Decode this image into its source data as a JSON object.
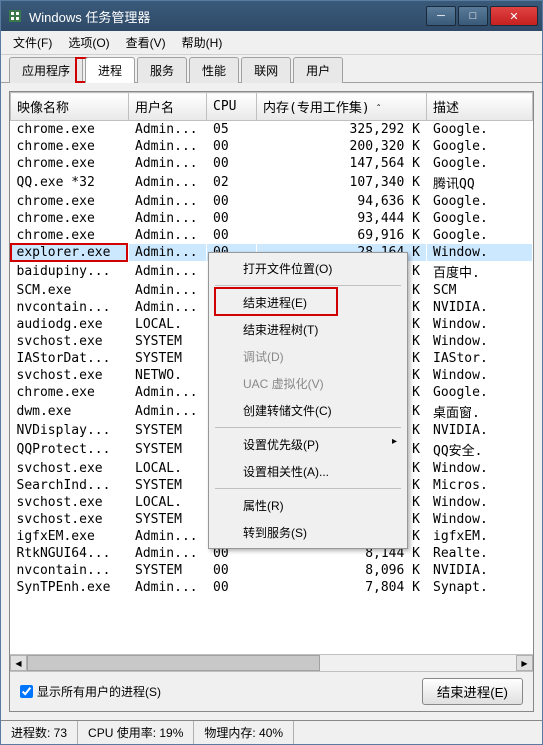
{
  "window": {
    "title": "Windows 任务管理器"
  },
  "menu": {
    "file": "文件(F)",
    "options": "选项(O)",
    "view": "查看(V)",
    "help": "帮助(H)"
  },
  "tabs": {
    "apps": "应用程序",
    "processes": "进程",
    "services": "服务",
    "performance": "性能",
    "networking": "联网",
    "users": "用户"
  },
  "columns": {
    "image": "映像名称",
    "user": "用户名",
    "cpu": "CPU",
    "memory": "内存(专用工作集)",
    "description": "描述"
  },
  "rows": [
    {
      "image": "chrome.exe",
      "user": "Admin...",
      "cpu": "05",
      "mem": "325,292 K",
      "desc": "Google."
    },
    {
      "image": "chrome.exe",
      "user": "Admin...",
      "cpu": "00",
      "mem": "200,320 K",
      "desc": "Google."
    },
    {
      "image": "chrome.exe",
      "user": "Admin...",
      "cpu": "00",
      "mem": "147,564 K",
      "desc": "Google."
    },
    {
      "image": "QQ.exe *32",
      "user": "Admin...",
      "cpu": "02",
      "mem": "107,340 K",
      "desc": "腾讯QQ"
    },
    {
      "image": "chrome.exe",
      "user": "Admin...",
      "cpu": "00",
      "mem": "94,636 K",
      "desc": "Google."
    },
    {
      "image": "chrome.exe",
      "user": "Admin...",
      "cpu": "00",
      "mem": "93,444 K",
      "desc": "Google."
    },
    {
      "image": "chrome.exe",
      "user": "Admin...",
      "cpu": "00",
      "mem": "69,916 K",
      "desc": "Google."
    },
    {
      "image": "explorer.exe",
      "user": "Admin...",
      "cpu": "00",
      "mem": "28,164 K",
      "desc": "Window."
    },
    {
      "image": "baidupiny...",
      "user": "Admin...",
      "cpu": "",
      "mem": "4 K",
      "desc": "百度中."
    },
    {
      "image": "SCM.exe",
      "user": "Admin...",
      "cpu": "",
      "mem": "6 K",
      "desc": "SCM"
    },
    {
      "image": "nvcontain...",
      "user": "Admin...",
      "cpu": "",
      "mem": "6 K",
      "desc": "NVIDIA."
    },
    {
      "image": "audiodg.exe",
      "user": "LOCAL.",
      "cpu": "",
      "mem": "2 K",
      "desc": "Window."
    },
    {
      "image": "svchost.exe",
      "user": "SYSTEM",
      "cpu": "",
      "mem": "0 K",
      "desc": "Window."
    },
    {
      "image": "IAStorDat...",
      "user": "SYSTEM",
      "cpu": "",
      "mem": "6 K",
      "desc": "IAStor."
    },
    {
      "image": "svchost.exe",
      "user": "NETWO.",
      "cpu": "",
      "mem": "6 K",
      "desc": "Window."
    },
    {
      "image": "chrome.exe",
      "user": "Admin...",
      "cpu": "",
      "mem": "6 K",
      "desc": "Google."
    },
    {
      "image": "dwm.exe",
      "user": "Admin...",
      "cpu": "",
      "mem": "4 K",
      "desc": "桌面窗."
    },
    {
      "image": "NVDisplay...",
      "user": "SYSTEM",
      "cpu": "",
      "mem": "4 K",
      "desc": "NVIDIA."
    },
    {
      "image": "QQProtect...",
      "user": "SYSTEM",
      "cpu": "",
      "mem": "2 K",
      "desc": "QQ安全."
    },
    {
      "image": "svchost.exe",
      "user": "LOCAL.",
      "cpu": "",
      "mem": "6 K",
      "desc": "Window."
    },
    {
      "image": "SearchInd...",
      "user": "SYSTEM",
      "cpu": "",
      "mem": "2 K",
      "desc": "Micros."
    },
    {
      "image": "svchost.exe",
      "user": "LOCAL.",
      "cpu": "",
      "mem": "2 K",
      "desc": "Window."
    },
    {
      "image": "svchost.exe",
      "user": "SYSTEM",
      "cpu": "00",
      "mem": "11,076 K",
      "desc": "Window."
    },
    {
      "image": "igfxEM.exe",
      "user": "Admin...",
      "cpu": "00",
      "mem": "10,972 K",
      "desc": "igfxEM."
    },
    {
      "image": "RtkNGUI64...",
      "user": "Admin...",
      "cpu": "00",
      "mem": "8,144 K",
      "desc": "Realte."
    },
    {
      "image": "nvcontain...",
      "user": "SYSTEM",
      "cpu": "00",
      "mem": "8,096 K",
      "desc": "NVIDIA."
    },
    {
      "image": "SynTPEnh.exe",
      "user": "Admin...",
      "cpu": "00",
      "mem": "7,804 K",
      "desc": "Synapt."
    }
  ],
  "context_menu": {
    "open_location": "打开文件位置(O)",
    "end_process": "结束进程(E)",
    "end_tree": "结束进程树(T)",
    "debug": "调试(D)",
    "uac": "UAC 虚拟化(V)",
    "create_dump": "创建转储文件(C)",
    "priority": "设置优先级(P)",
    "affinity": "设置相关性(A)...",
    "properties": "属性(R)",
    "goto_services": "转到服务(S)"
  },
  "footer": {
    "show_all_users": "显示所有用户的进程(S)",
    "end_process_btn": "结束进程(E)"
  },
  "status": {
    "processes": "进程数: 73",
    "cpu": "CPU 使用率: 19%",
    "mem": "物理内存: 40%"
  }
}
